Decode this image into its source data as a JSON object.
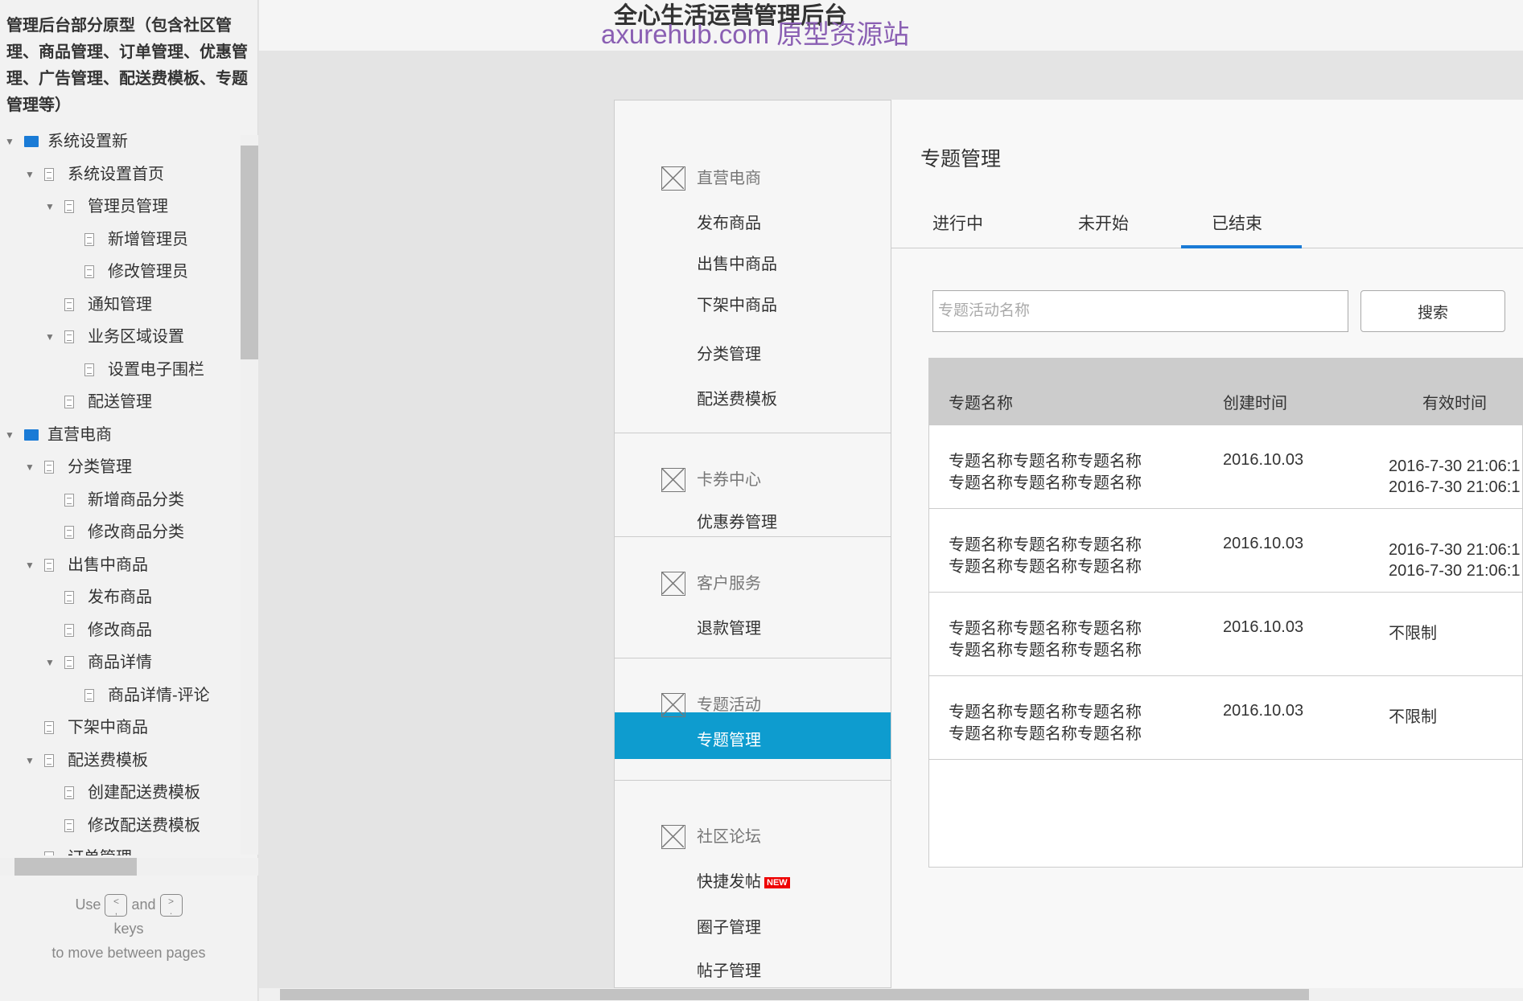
{
  "sidebar": {
    "project_title": "管理后台部分原型（包含社区管理、商品管理、订单管理、优惠管理、广告管理、配送费模板、专题管理等）",
    "tree": [
      {
        "level": 0,
        "type": "folder",
        "expanded": true,
        "label": "系统设置新"
      },
      {
        "level": 1,
        "type": "page",
        "expanded": true,
        "label": "系统设置首页"
      },
      {
        "level": 2,
        "type": "page",
        "expanded": true,
        "label": "管理员管理"
      },
      {
        "level": 3,
        "type": "page",
        "label": "新增管理员"
      },
      {
        "level": 3,
        "type": "page",
        "label": "修改管理员"
      },
      {
        "level": 2,
        "type": "page",
        "label": "通知管理"
      },
      {
        "level": 2,
        "type": "page",
        "expanded": true,
        "label": "业务区域设置"
      },
      {
        "level": 3,
        "type": "page",
        "label": "设置电子围栏"
      },
      {
        "level": 2,
        "type": "page",
        "label": "配送管理"
      },
      {
        "level": 0,
        "type": "folder",
        "expanded": true,
        "label": "直营电商"
      },
      {
        "level": 1,
        "type": "page",
        "expanded": true,
        "label": "分类管理"
      },
      {
        "level": 2,
        "type": "page",
        "label": "新增商品分类"
      },
      {
        "level": 2,
        "type": "page",
        "label": "修改商品分类"
      },
      {
        "level": 1,
        "type": "page",
        "expanded": true,
        "label": "出售中商品"
      },
      {
        "level": 2,
        "type": "page",
        "label": "发布商品"
      },
      {
        "level": 2,
        "type": "page",
        "label": "修改商品"
      },
      {
        "level": 2,
        "type": "page",
        "expanded": true,
        "label": "商品详情"
      },
      {
        "level": 3,
        "type": "page",
        "label": "商品详情-评论"
      },
      {
        "level": 1,
        "type": "page",
        "label": "下架中商品"
      },
      {
        "level": 1,
        "type": "page",
        "expanded": true,
        "label": "配送费模板"
      },
      {
        "level": 2,
        "type": "page",
        "label": "创建配送费模板"
      },
      {
        "level": 2,
        "type": "page",
        "label": "修改配送费模板"
      },
      {
        "level": 1,
        "type": "page",
        "expanded": true,
        "label": "订单管理"
      }
    ],
    "help": {
      "use": "Use",
      "key_prev": "<\n,",
      "and": "and",
      "key_next": ">\n.",
      "keys": "keys",
      "rest": "to move between pages"
    }
  },
  "header": {
    "title": "全心生活运营管理后台",
    "watermark": "axurehub.com 原型资源站"
  },
  "menu": {
    "groups": [
      {
        "label": "直营电商",
        "items": [
          "发布商品",
          "出售中商品",
          "下架中商品",
          "分类管理",
          "配送费模板"
        ]
      },
      {
        "label": "卡券中心",
        "items": [
          "优惠券管理"
        ]
      },
      {
        "label": "客户服务",
        "items": [
          "退款管理"
        ]
      },
      {
        "label": "专题活动",
        "items": [
          "专题管理"
        ]
      },
      {
        "label": "社区论坛",
        "items": [
          "快捷发帖",
          "圈子管理",
          "帖子管理"
        ]
      }
    ],
    "active": "专题管理",
    "new_badge": "NEW",
    "accent": "#0e9ccf"
  },
  "main": {
    "title": "专题管理",
    "tabs": [
      "进行中",
      "未开始",
      "已结束"
    ],
    "active_tab": "已结束",
    "search": {
      "placeholder": "专题活动名称",
      "button": "搜索"
    },
    "table": {
      "headers": [
        "专题名称",
        "创建时间",
        "有效时间"
      ],
      "rows": [
        {
          "name": [
            "专题名称专题名称专题名称",
            "专题名称专题名称专题名称"
          ],
          "created": "2016.10.03",
          "valid": [
            "2016-7-30 21:06:1",
            "2016-7-30 21:06:1"
          ]
        },
        {
          "name": [
            "专题名称专题名称专题名称",
            "专题名称专题名称专题名称"
          ],
          "created": "2016.10.03",
          "valid": [
            "2016-7-30 21:06:1",
            "2016-7-30 21:06:1"
          ]
        },
        {
          "name": [
            "专题名称专题名称专题名称",
            "专题名称专题名称专题名称"
          ],
          "created": "2016.10.03",
          "valid": [
            "不限制"
          ]
        },
        {
          "name": [
            "专题名称专题名称专题名称",
            "专题名称专题名称专题名称"
          ],
          "created": "2016.10.03",
          "valid": [
            "不限制"
          ]
        }
      ]
    }
  }
}
